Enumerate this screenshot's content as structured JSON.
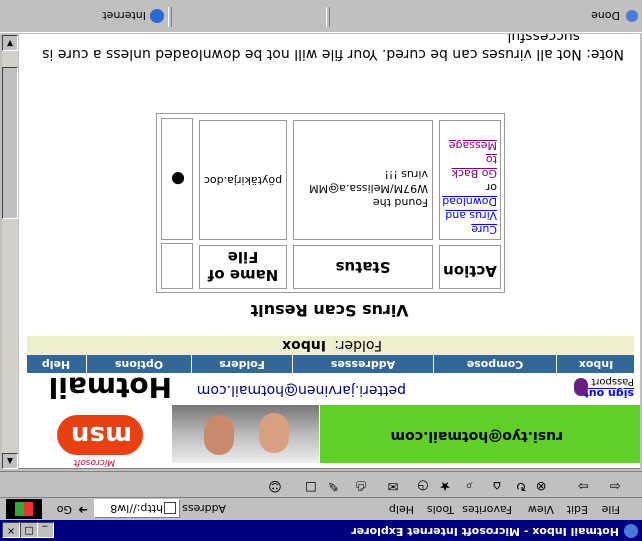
{
  "window": {
    "title": "Hotmail Inbox - Microsoft Internet Explorer",
    "controls": [
      "_",
      "□",
      "×"
    ]
  },
  "menu": [
    "File",
    "Edit",
    "View",
    "Favorites",
    "Tools",
    "Help"
  ],
  "address": {
    "label": "Address",
    "value": "http://lw8",
    "go_label": "Go"
  },
  "toolbar_icons": [
    "back-icon",
    "forward-icon",
    "stop-icon",
    "refresh-icon",
    "home-icon",
    "search-icon",
    "favorites-icon",
    "history-icon",
    "mail-icon",
    "print-icon",
    "edit-icon",
    "discuss-icon",
    "messenger-icon"
  ],
  "header": {
    "banner_email": "rusi.tyo@hotmail.com",
    "logo_text": "msn",
    "logo_maker": "Microsoft",
    "sign_out": "sign out",
    "passport": "Passport",
    "user_email": "petteri.jarvinen@hotmail.com",
    "product": "Hotmail"
  },
  "nav": [
    "Inbox",
    "Compose",
    "Addresses",
    "Folders",
    "Options",
    "Help"
  ],
  "folder": {
    "label": "Folder:",
    "name": "Inbox"
  },
  "scan": {
    "title": "Virus Scan Result",
    "headers": {
      "file": "Name of File",
      "status": "Status",
      "action": "Action"
    },
    "row": {
      "file": "pöytäkirja.doc",
      "status_line1": "Found the",
      "status_line2": "W97M/Melissa.a@MM",
      "status_line3": "virus !!!",
      "action_cure1": "Cure",
      "action_cure2": "Virus and",
      "action_cure3": "Download",
      "action_or": "or",
      "action_back1": "Go Back",
      "action_back2": "to",
      "action_back3": "Message"
    }
  },
  "note": {
    "line1": "Note:  Not all viruses can be cured.  Your file will not be downloaded unless a cure is",
    "line2": "successful."
  },
  "status": {
    "text": "Done",
    "zone": "Internet"
  }
}
